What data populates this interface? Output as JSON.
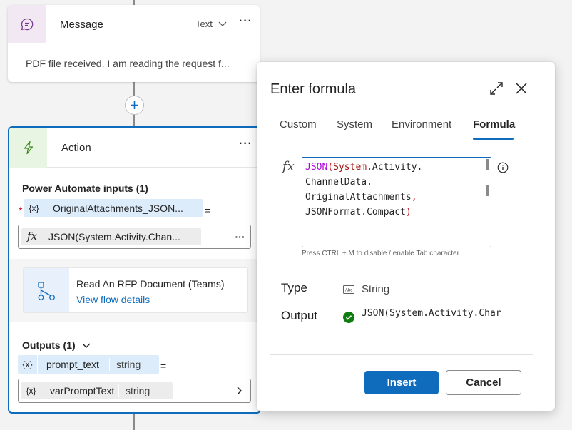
{
  "message_node": {
    "title": "Message",
    "type_selector": "Text",
    "more_label": "···",
    "body": "PDF file received. I am reading the request f..."
  },
  "action_node": {
    "title": "Action",
    "more_label": "···",
    "inputs_title": "Power Automate inputs (1)",
    "input_required_marker": "*",
    "var_glyph": "{x}",
    "input_var": "OriginalAttachments_JSON...",
    "equals": "=",
    "input_formula_symbol": "fx",
    "input_formula": "JSON(System.Activity.Chan...",
    "input_more_label": "···",
    "flow_name": "Read An RFP Document (Teams)",
    "flow_link": "View flow details",
    "outputs_title": "Outputs (1)",
    "output_var": "prompt_text",
    "output_var_type": "string",
    "output_target": "varPromptText",
    "output_target_type": "string"
  },
  "dialog": {
    "title": "Enter formula",
    "tabs": [
      {
        "label": "Custom",
        "active": false
      },
      {
        "label": "System",
        "active": false
      },
      {
        "label": "Environment",
        "active": false
      },
      {
        "label": "Formula",
        "active": true
      }
    ],
    "fx_label": "fx",
    "formula_tokens": {
      "fn": "JSON",
      "open": "(",
      "ns": "System",
      "l1rest": ".Activity.",
      "l2": "ChannelData.",
      "l3": "OriginalAttachments",
      "comma": ",",
      "l4": "JSONFormat.Compact",
      "close": ")"
    },
    "hint": "Press CTRL + M to disable / enable Tab character",
    "type_label": "Type",
    "type_icon_text": "Abc",
    "type_value": "String",
    "output_label": "Output",
    "output_value": "JSON(System.Activity.Char",
    "insert_label": "Insert",
    "cancel_label": "Cancel"
  },
  "colors": {
    "accent": "#0f6cbd",
    "success": "#107c10",
    "required": "#c50f1f"
  },
  "icons": {
    "message": "chat-bubble-icon",
    "action": "lightning-icon",
    "flow": "flow-icon",
    "expand": "expand-icon",
    "close": "close-icon",
    "info": "info-icon",
    "ok": "check-circle-icon"
  }
}
